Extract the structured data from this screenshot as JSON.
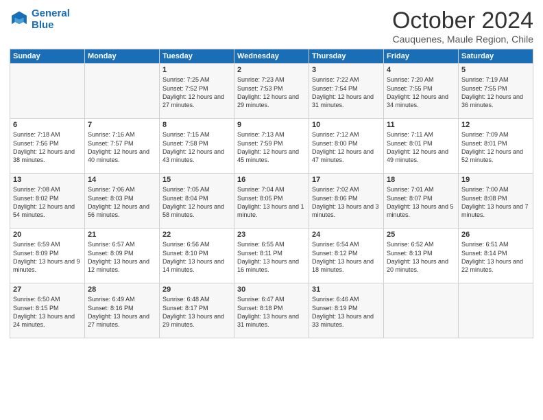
{
  "header": {
    "logo_line1": "General",
    "logo_line2": "Blue",
    "month": "October 2024",
    "location": "Cauquenes, Maule Region, Chile"
  },
  "days_of_week": [
    "Sunday",
    "Monday",
    "Tuesday",
    "Wednesday",
    "Thursday",
    "Friday",
    "Saturday"
  ],
  "weeks": [
    [
      {
        "day": "",
        "sunrise": "",
        "sunset": "",
        "daylight": ""
      },
      {
        "day": "",
        "sunrise": "",
        "sunset": "",
        "daylight": ""
      },
      {
        "day": "1",
        "sunrise": "Sunrise: 7:25 AM",
        "sunset": "Sunset: 7:52 PM",
        "daylight": "Daylight: 12 hours and 27 minutes."
      },
      {
        "day": "2",
        "sunrise": "Sunrise: 7:23 AM",
        "sunset": "Sunset: 7:53 PM",
        "daylight": "Daylight: 12 hours and 29 minutes."
      },
      {
        "day": "3",
        "sunrise": "Sunrise: 7:22 AM",
        "sunset": "Sunset: 7:54 PM",
        "daylight": "Daylight: 12 hours and 31 minutes."
      },
      {
        "day": "4",
        "sunrise": "Sunrise: 7:20 AM",
        "sunset": "Sunset: 7:55 PM",
        "daylight": "Daylight: 12 hours and 34 minutes."
      },
      {
        "day": "5",
        "sunrise": "Sunrise: 7:19 AM",
        "sunset": "Sunset: 7:55 PM",
        "daylight": "Daylight: 12 hours and 36 minutes."
      }
    ],
    [
      {
        "day": "6",
        "sunrise": "Sunrise: 7:18 AM",
        "sunset": "Sunset: 7:56 PM",
        "daylight": "Daylight: 12 hours and 38 minutes."
      },
      {
        "day": "7",
        "sunrise": "Sunrise: 7:16 AM",
        "sunset": "Sunset: 7:57 PM",
        "daylight": "Daylight: 12 hours and 40 minutes."
      },
      {
        "day": "8",
        "sunrise": "Sunrise: 7:15 AM",
        "sunset": "Sunset: 7:58 PM",
        "daylight": "Daylight: 12 hours and 43 minutes."
      },
      {
        "day": "9",
        "sunrise": "Sunrise: 7:13 AM",
        "sunset": "Sunset: 7:59 PM",
        "daylight": "Daylight: 12 hours and 45 minutes."
      },
      {
        "day": "10",
        "sunrise": "Sunrise: 7:12 AM",
        "sunset": "Sunset: 8:00 PM",
        "daylight": "Daylight: 12 hours and 47 minutes."
      },
      {
        "day": "11",
        "sunrise": "Sunrise: 7:11 AM",
        "sunset": "Sunset: 8:01 PM",
        "daylight": "Daylight: 12 hours and 49 minutes."
      },
      {
        "day": "12",
        "sunrise": "Sunrise: 7:09 AM",
        "sunset": "Sunset: 8:01 PM",
        "daylight": "Daylight: 12 hours and 52 minutes."
      }
    ],
    [
      {
        "day": "13",
        "sunrise": "Sunrise: 7:08 AM",
        "sunset": "Sunset: 8:02 PM",
        "daylight": "Daylight: 12 hours and 54 minutes."
      },
      {
        "day": "14",
        "sunrise": "Sunrise: 7:06 AM",
        "sunset": "Sunset: 8:03 PM",
        "daylight": "Daylight: 12 hours and 56 minutes."
      },
      {
        "day": "15",
        "sunrise": "Sunrise: 7:05 AM",
        "sunset": "Sunset: 8:04 PM",
        "daylight": "Daylight: 12 hours and 58 minutes."
      },
      {
        "day": "16",
        "sunrise": "Sunrise: 7:04 AM",
        "sunset": "Sunset: 8:05 PM",
        "daylight": "Daylight: 13 hours and 1 minute."
      },
      {
        "day": "17",
        "sunrise": "Sunrise: 7:02 AM",
        "sunset": "Sunset: 8:06 PM",
        "daylight": "Daylight: 13 hours and 3 minutes."
      },
      {
        "day": "18",
        "sunrise": "Sunrise: 7:01 AM",
        "sunset": "Sunset: 8:07 PM",
        "daylight": "Daylight: 13 hours and 5 minutes."
      },
      {
        "day": "19",
        "sunrise": "Sunrise: 7:00 AM",
        "sunset": "Sunset: 8:08 PM",
        "daylight": "Daylight: 13 hours and 7 minutes."
      }
    ],
    [
      {
        "day": "20",
        "sunrise": "Sunrise: 6:59 AM",
        "sunset": "Sunset: 8:09 PM",
        "daylight": "Daylight: 13 hours and 9 minutes."
      },
      {
        "day": "21",
        "sunrise": "Sunrise: 6:57 AM",
        "sunset": "Sunset: 8:09 PM",
        "daylight": "Daylight: 13 hours and 12 minutes."
      },
      {
        "day": "22",
        "sunrise": "Sunrise: 6:56 AM",
        "sunset": "Sunset: 8:10 PM",
        "daylight": "Daylight: 13 hours and 14 minutes."
      },
      {
        "day": "23",
        "sunrise": "Sunrise: 6:55 AM",
        "sunset": "Sunset: 8:11 PM",
        "daylight": "Daylight: 13 hours and 16 minutes."
      },
      {
        "day": "24",
        "sunrise": "Sunrise: 6:54 AM",
        "sunset": "Sunset: 8:12 PM",
        "daylight": "Daylight: 13 hours and 18 minutes."
      },
      {
        "day": "25",
        "sunrise": "Sunrise: 6:52 AM",
        "sunset": "Sunset: 8:13 PM",
        "daylight": "Daylight: 13 hours and 20 minutes."
      },
      {
        "day": "26",
        "sunrise": "Sunrise: 6:51 AM",
        "sunset": "Sunset: 8:14 PM",
        "daylight": "Daylight: 13 hours and 22 minutes."
      }
    ],
    [
      {
        "day": "27",
        "sunrise": "Sunrise: 6:50 AM",
        "sunset": "Sunset: 8:15 PM",
        "daylight": "Daylight: 13 hours and 24 minutes."
      },
      {
        "day": "28",
        "sunrise": "Sunrise: 6:49 AM",
        "sunset": "Sunset: 8:16 PM",
        "daylight": "Daylight: 13 hours and 27 minutes."
      },
      {
        "day": "29",
        "sunrise": "Sunrise: 6:48 AM",
        "sunset": "Sunset: 8:17 PM",
        "daylight": "Daylight: 13 hours and 29 minutes."
      },
      {
        "day": "30",
        "sunrise": "Sunrise: 6:47 AM",
        "sunset": "Sunset: 8:18 PM",
        "daylight": "Daylight: 13 hours and 31 minutes."
      },
      {
        "day": "31",
        "sunrise": "Sunrise: 6:46 AM",
        "sunset": "Sunset: 8:19 PM",
        "daylight": "Daylight: 13 hours and 33 minutes."
      },
      {
        "day": "",
        "sunrise": "",
        "sunset": "",
        "daylight": ""
      },
      {
        "day": "",
        "sunrise": "",
        "sunset": "",
        "daylight": ""
      }
    ]
  ]
}
